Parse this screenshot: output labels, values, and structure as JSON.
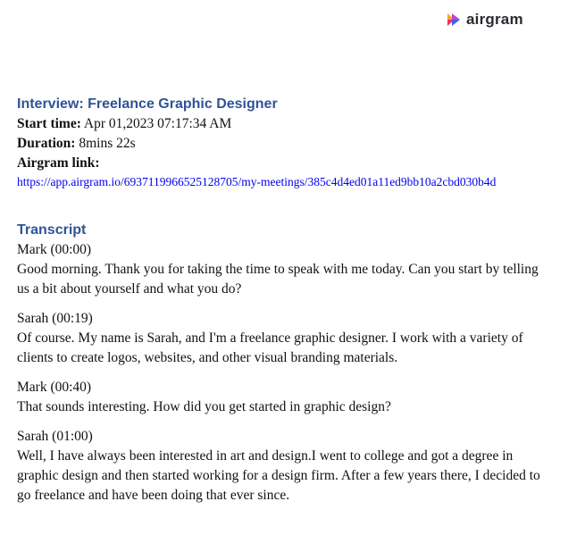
{
  "brand": {
    "name": "airgram"
  },
  "meeting": {
    "title": "Interview: Freelance Graphic Designer",
    "start_label": "Start time:",
    "start_value": "Apr 01,2023 07:17:34 AM",
    "duration_label": "Duration:",
    "duration_value": "8mins 22s",
    "link_label": "Airgram link:",
    "link_url": "https://app.airgram.io/6937119966525128705/my-meetings/385c4d4ed01a11ed9bb10a2cbd030b4d"
  },
  "transcript": {
    "title": "Transcript",
    "entries": [
      {
        "speaker": "Mark (00:00)",
        "text": "Good morning. Thank you for taking the time to speak with me today. Can you start by telling us a bit about yourself and what you do?"
      },
      {
        "speaker": "Sarah (00:19)",
        "text": "Of course. My name is Sarah, and I'm a freelance graphic designer. I work with a variety of clients to create logos, websites, and other visual branding materials."
      },
      {
        "speaker": "Mark (00:40)",
        "text": "That sounds interesting. How did you get started in graphic design?"
      },
      {
        "speaker": "Sarah (01:00)",
        "text": " Well, I have always been interested in art and design.I went to college and got a degree in graphic design and then started working for a design firm. After a few years there, I decided to go freelance and have been doing that ever since."
      }
    ]
  }
}
